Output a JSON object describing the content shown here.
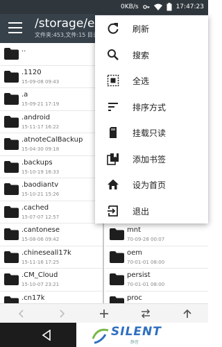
{
  "status_bar": {
    "speed": "0KB/s",
    "time": "17:47:23"
  },
  "toolbar": {
    "path": "/storage/emulated/0",
    "subtitle": "文件夹:453,文件:15 目录"
  },
  "left_pane": {
    "items": [
      {
        "name": "..",
        "date": ""
      },
      {
        "name": ".1120",
        "date": "15-09-08 09:43"
      },
      {
        "name": ".a",
        "date": "15-09-21 17:19"
      },
      {
        "name": ".android",
        "date": "15-11-17 16:22"
      },
      {
        "name": ".atnoteCalBackup",
        "date": "15-04-30 09:18"
      },
      {
        "name": ".backups",
        "date": "15-10-19 16:33"
      },
      {
        "name": ".baodiantv",
        "date": "15-10-21 15:26"
      },
      {
        "name": ".cached",
        "date": "15-07-07 12:57"
      },
      {
        "name": ".cantonese",
        "date": "15-08-06 09:42"
      },
      {
        "name": ".chineseall17k",
        "date": "15-11-16 17:25"
      },
      {
        "name": ".CM_Cloud",
        "date": "15-10-07 23:21"
      },
      {
        "name": ".cn17k",
        "date": ""
      }
    ]
  },
  "right_pane": {
    "items": [
      {
        "name": "",
        "date": ""
      },
      {
        "name": "",
        "date": ""
      },
      {
        "name": "",
        "date": ""
      },
      {
        "name": "",
        "date": ""
      },
      {
        "name": "",
        "date": ""
      },
      {
        "name": "",
        "date": ""
      },
      {
        "name": "",
        "date": ""
      },
      {
        "name": "",
        "date": ""
      },
      {
        "name": "mnt",
        "date": "70-09-28 00:07"
      },
      {
        "name": "oem",
        "date": "70-01-01 08:00"
      },
      {
        "name": "persist",
        "date": "70-01-01 08:00"
      },
      {
        "name": "proc",
        "date": ""
      }
    ]
  },
  "menu": {
    "items": [
      {
        "label": "刷新",
        "icon": "refresh-icon"
      },
      {
        "label": "搜索",
        "icon": "search-icon"
      },
      {
        "label": "全选",
        "icon": "select-all-icon"
      },
      {
        "label": "排序方式",
        "icon": "sort-icon"
      },
      {
        "label": "挂载只读",
        "icon": "sd-card-icon"
      },
      {
        "label": "添加书签",
        "icon": "bookmark-add-icon"
      },
      {
        "label": "设为首页",
        "icon": "home-icon"
      },
      {
        "label": "退出",
        "icon": "exit-icon"
      }
    ]
  },
  "watermark": {
    "text": "SILENT",
    "sub": "静音"
  },
  "colors": {
    "toolbar": "#37414a",
    "status_bar": "#2f373d",
    "folder": "#1e1e1e",
    "accent": "#2f6fbf"
  }
}
